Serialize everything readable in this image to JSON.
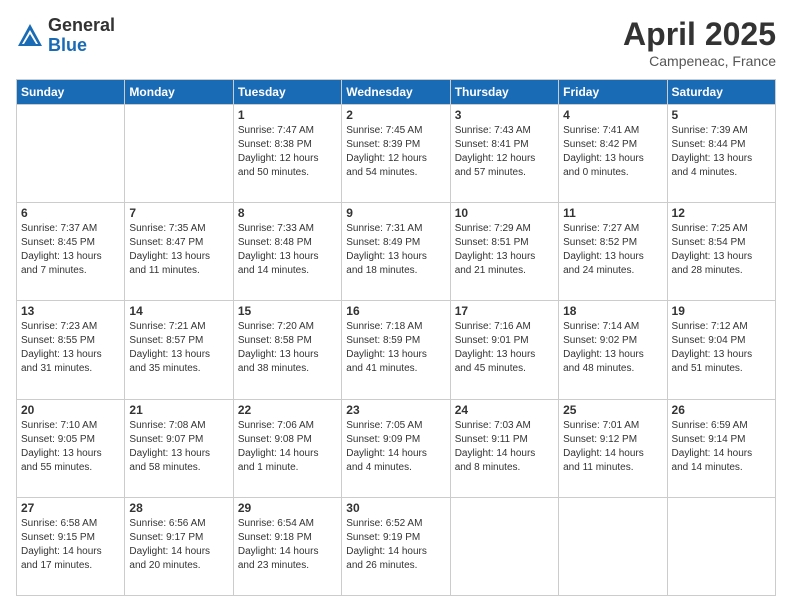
{
  "header": {
    "logo_general": "General",
    "logo_blue": "Blue",
    "month_title": "April 2025",
    "subtitle": "Campeneac, France"
  },
  "weekdays": [
    "Sunday",
    "Monday",
    "Tuesday",
    "Wednesday",
    "Thursday",
    "Friday",
    "Saturday"
  ],
  "weeks": [
    [
      {
        "day": null
      },
      {
        "day": null
      },
      {
        "day": "1",
        "sunrise": "Sunrise: 7:47 AM",
        "sunset": "Sunset: 8:38 PM",
        "daylight": "Daylight: 12 hours and 50 minutes."
      },
      {
        "day": "2",
        "sunrise": "Sunrise: 7:45 AM",
        "sunset": "Sunset: 8:39 PM",
        "daylight": "Daylight: 12 hours and 54 minutes."
      },
      {
        "day": "3",
        "sunrise": "Sunrise: 7:43 AM",
        "sunset": "Sunset: 8:41 PM",
        "daylight": "Daylight: 12 hours and 57 minutes."
      },
      {
        "day": "4",
        "sunrise": "Sunrise: 7:41 AM",
        "sunset": "Sunset: 8:42 PM",
        "daylight": "Daylight: 13 hours and 0 minutes."
      },
      {
        "day": "5",
        "sunrise": "Sunrise: 7:39 AM",
        "sunset": "Sunset: 8:44 PM",
        "daylight": "Daylight: 13 hours and 4 minutes."
      }
    ],
    [
      {
        "day": "6",
        "sunrise": "Sunrise: 7:37 AM",
        "sunset": "Sunset: 8:45 PM",
        "daylight": "Daylight: 13 hours and 7 minutes."
      },
      {
        "day": "7",
        "sunrise": "Sunrise: 7:35 AM",
        "sunset": "Sunset: 8:47 PM",
        "daylight": "Daylight: 13 hours and 11 minutes."
      },
      {
        "day": "8",
        "sunrise": "Sunrise: 7:33 AM",
        "sunset": "Sunset: 8:48 PM",
        "daylight": "Daylight: 13 hours and 14 minutes."
      },
      {
        "day": "9",
        "sunrise": "Sunrise: 7:31 AM",
        "sunset": "Sunset: 8:49 PM",
        "daylight": "Daylight: 13 hours and 18 minutes."
      },
      {
        "day": "10",
        "sunrise": "Sunrise: 7:29 AM",
        "sunset": "Sunset: 8:51 PM",
        "daylight": "Daylight: 13 hours and 21 minutes."
      },
      {
        "day": "11",
        "sunrise": "Sunrise: 7:27 AM",
        "sunset": "Sunset: 8:52 PM",
        "daylight": "Daylight: 13 hours and 24 minutes."
      },
      {
        "day": "12",
        "sunrise": "Sunrise: 7:25 AM",
        "sunset": "Sunset: 8:54 PM",
        "daylight": "Daylight: 13 hours and 28 minutes."
      }
    ],
    [
      {
        "day": "13",
        "sunrise": "Sunrise: 7:23 AM",
        "sunset": "Sunset: 8:55 PM",
        "daylight": "Daylight: 13 hours and 31 minutes."
      },
      {
        "day": "14",
        "sunrise": "Sunrise: 7:21 AM",
        "sunset": "Sunset: 8:57 PM",
        "daylight": "Daylight: 13 hours and 35 minutes."
      },
      {
        "day": "15",
        "sunrise": "Sunrise: 7:20 AM",
        "sunset": "Sunset: 8:58 PM",
        "daylight": "Daylight: 13 hours and 38 minutes."
      },
      {
        "day": "16",
        "sunrise": "Sunrise: 7:18 AM",
        "sunset": "Sunset: 8:59 PM",
        "daylight": "Daylight: 13 hours and 41 minutes."
      },
      {
        "day": "17",
        "sunrise": "Sunrise: 7:16 AM",
        "sunset": "Sunset: 9:01 PM",
        "daylight": "Daylight: 13 hours and 45 minutes."
      },
      {
        "day": "18",
        "sunrise": "Sunrise: 7:14 AM",
        "sunset": "Sunset: 9:02 PM",
        "daylight": "Daylight: 13 hours and 48 minutes."
      },
      {
        "day": "19",
        "sunrise": "Sunrise: 7:12 AM",
        "sunset": "Sunset: 9:04 PM",
        "daylight": "Daylight: 13 hours and 51 minutes."
      }
    ],
    [
      {
        "day": "20",
        "sunrise": "Sunrise: 7:10 AM",
        "sunset": "Sunset: 9:05 PM",
        "daylight": "Daylight: 13 hours and 55 minutes."
      },
      {
        "day": "21",
        "sunrise": "Sunrise: 7:08 AM",
        "sunset": "Sunset: 9:07 PM",
        "daylight": "Daylight: 13 hours and 58 minutes."
      },
      {
        "day": "22",
        "sunrise": "Sunrise: 7:06 AM",
        "sunset": "Sunset: 9:08 PM",
        "daylight": "Daylight: 14 hours and 1 minute."
      },
      {
        "day": "23",
        "sunrise": "Sunrise: 7:05 AM",
        "sunset": "Sunset: 9:09 PM",
        "daylight": "Daylight: 14 hours and 4 minutes."
      },
      {
        "day": "24",
        "sunrise": "Sunrise: 7:03 AM",
        "sunset": "Sunset: 9:11 PM",
        "daylight": "Daylight: 14 hours and 8 minutes."
      },
      {
        "day": "25",
        "sunrise": "Sunrise: 7:01 AM",
        "sunset": "Sunset: 9:12 PM",
        "daylight": "Daylight: 14 hours and 11 minutes."
      },
      {
        "day": "26",
        "sunrise": "Sunrise: 6:59 AM",
        "sunset": "Sunset: 9:14 PM",
        "daylight": "Daylight: 14 hours and 14 minutes."
      }
    ],
    [
      {
        "day": "27",
        "sunrise": "Sunrise: 6:58 AM",
        "sunset": "Sunset: 9:15 PM",
        "daylight": "Daylight: 14 hours and 17 minutes."
      },
      {
        "day": "28",
        "sunrise": "Sunrise: 6:56 AM",
        "sunset": "Sunset: 9:17 PM",
        "daylight": "Daylight: 14 hours and 20 minutes."
      },
      {
        "day": "29",
        "sunrise": "Sunrise: 6:54 AM",
        "sunset": "Sunset: 9:18 PM",
        "daylight": "Daylight: 14 hours and 23 minutes."
      },
      {
        "day": "30",
        "sunrise": "Sunrise: 6:52 AM",
        "sunset": "Sunset: 9:19 PM",
        "daylight": "Daylight: 14 hours and 26 minutes."
      },
      {
        "day": null
      },
      {
        "day": null
      },
      {
        "day": null
      }
    ]
  ]
}
